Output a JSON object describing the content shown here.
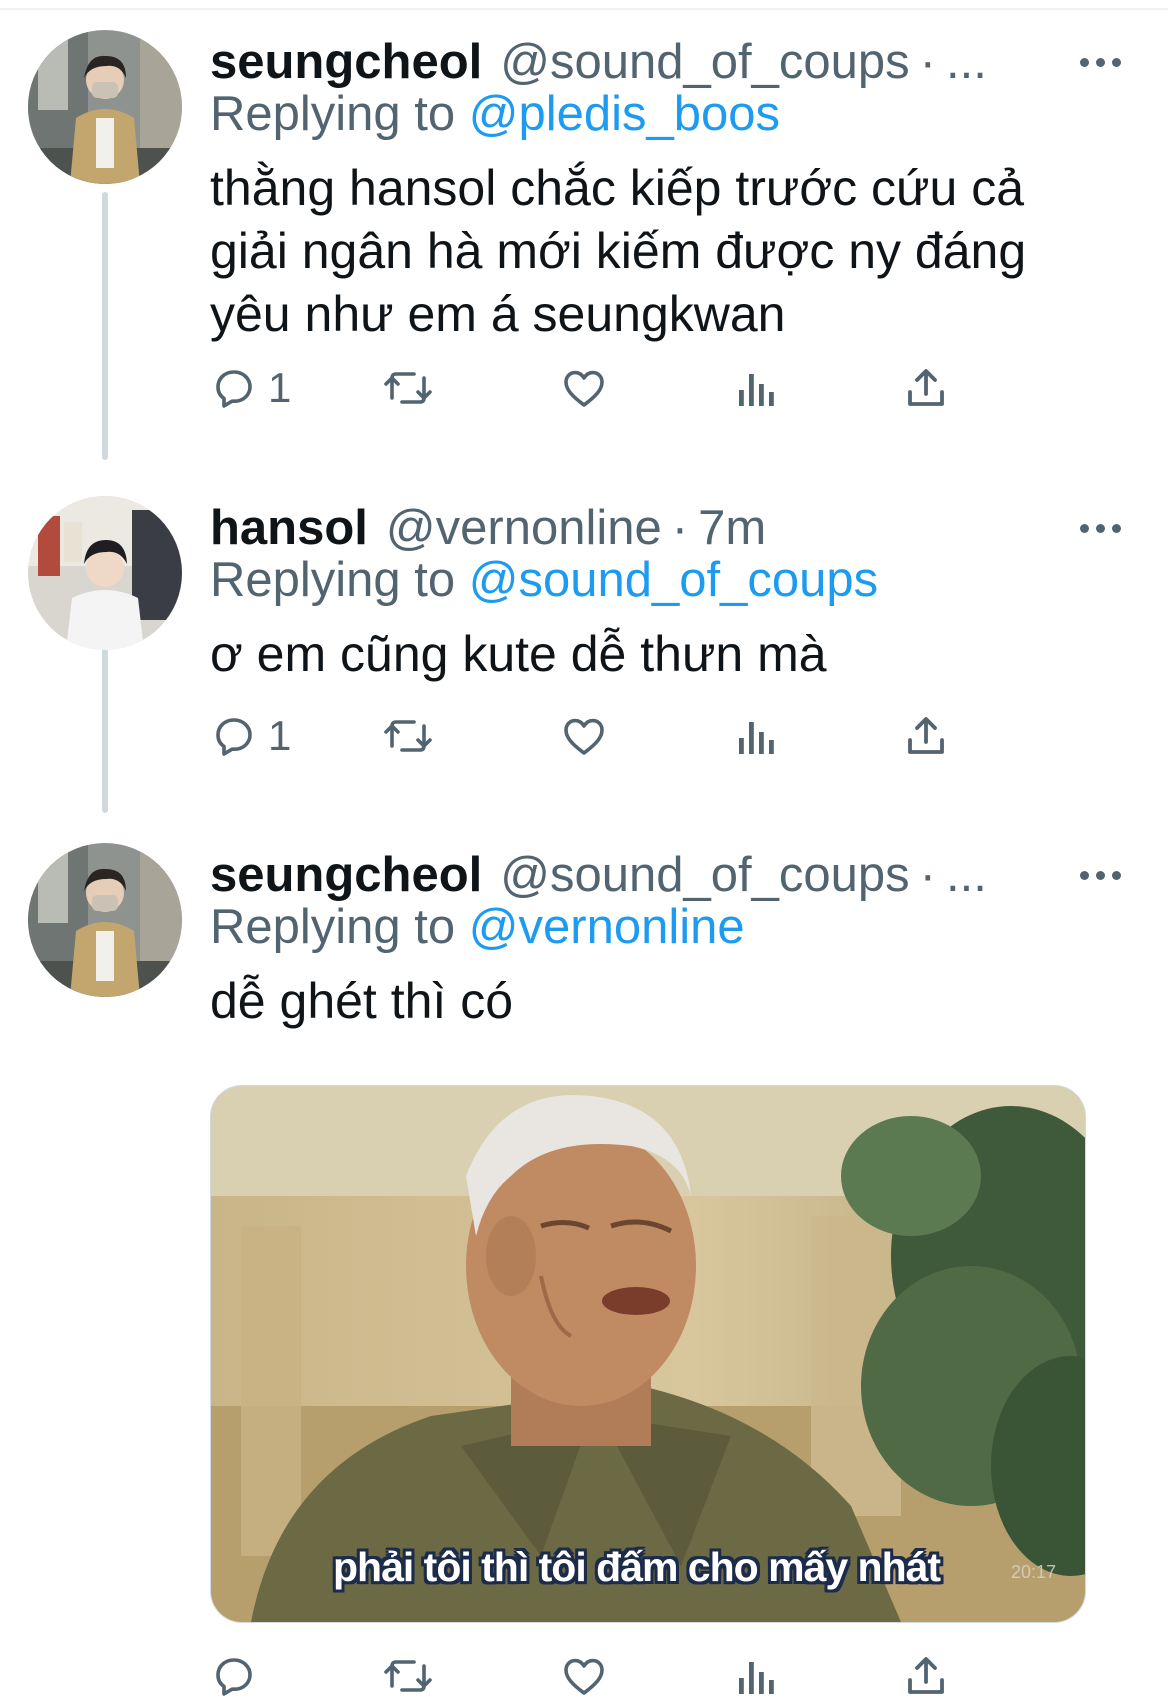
{
  "tweets": [
    {
      "name": "seungcheol",
      "handle": "@sound_of_coups",
      "sep": "·",
      "time": "...",
      "replying_prefix": "Replying to ",
      "replying_to": "@pledis_boos",
      "text_lines": [
        "thằng hansol chắc kiếp trước cứu cả",
        "giải ngân hà mới kiếm được ny đáng",
        "yêu như em á seungkwan"
      ],
      "reply_count": "1"
    },
    {
      "name": "hansol",
      "handle": "@vernonline",
      "sep": "·",
      "time": "7m",
      "replying_prefix": "Replying to ",
      "replying_to": "@sound_of_coups",
      "text_lines": [
        "ơ em cũng kute dễ thưn mà"
      ],
      "reply_count": "1"
    },
    {
      "name": "seungcheol",
      "handle": "@sound_of_coups",
      "sep": "·",
      "time": "...",
      "replying_prefix": "Replying to ",
      "replying_to": "@vernonline",
      "text_lines": [
        "dễ ghét thì có"
      ],
      "reply_count": "",
      "media": {
        "subtitle": "phải tôi thì tôi đấm cho mấy nhát",
        "watermark": "20:17"
      }
    }
  ],
  "icons": {
    "reply": "reply-icon",
    "retweet": "retweet-icon",
    "like": "heart-icon",
    "views": "views-icon",
    "share": "share-icon",
    "more": "more-icon"
  },
  "colors": {
    "link": "#1d9bf0",
    "secondary": "#536471",
    "text": "#0f1419",
    "thread_line": "#cfd9de"
  }
}
